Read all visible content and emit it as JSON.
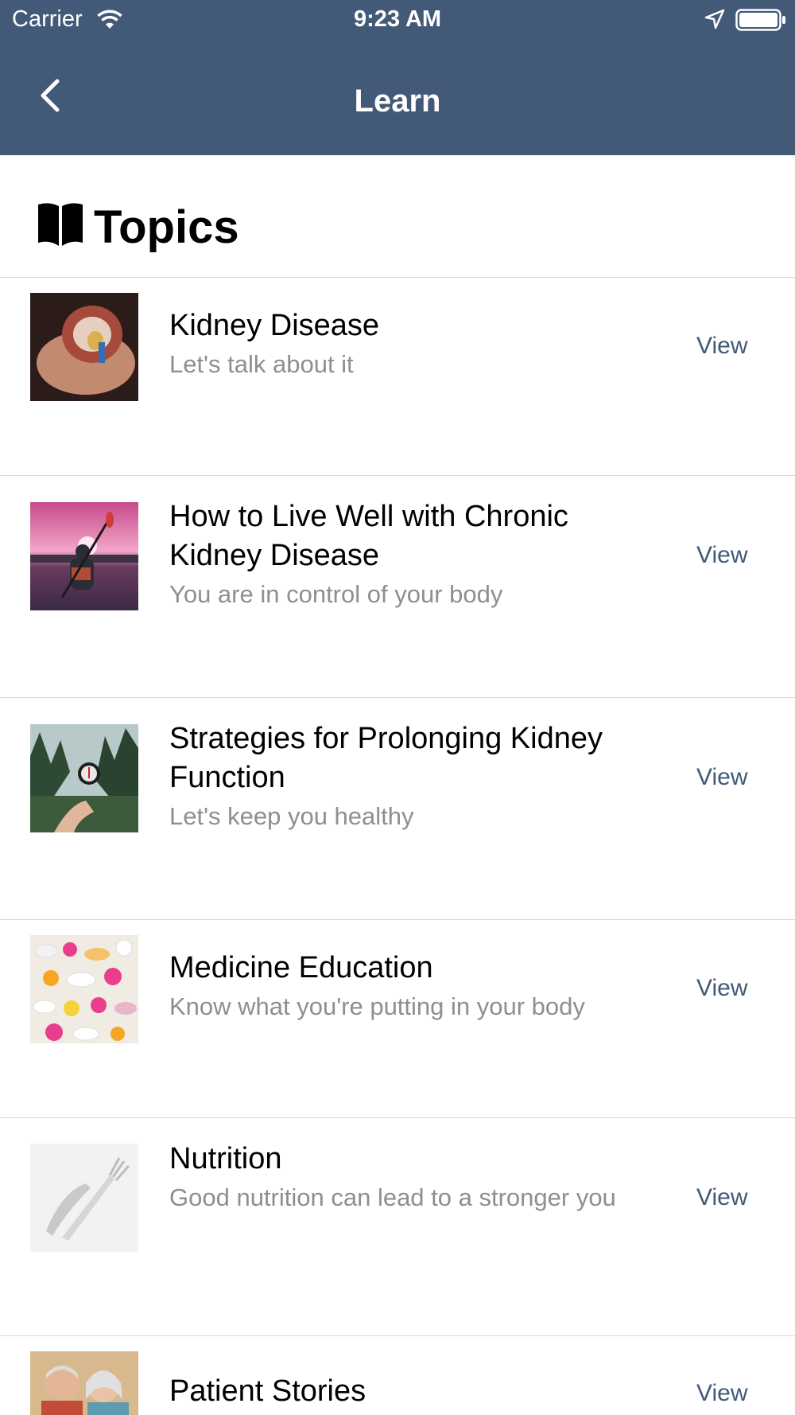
{
  "status_bar": {
    "carrier": "Carrier",
    "time": "9:23 AM",
    "icons": [
      "wifi-icon",
      "location-icon",
      "battery-icon"
    ]
  },
  "nav": {
    "back_icon": "chevron-left-icon",
    "title": "Learn"
  },
  "section": {
    "icon": "book-icon",
    "title": "Topics"
  },
  "topics": [
    {
      "title": "Kidney Disease",
      "subtitle": "Let's talk about it",
      "action": "View",
      "image": "kidney-model-photo"
    },
    {
      "title": "How to Live Well with Chronic Kidney Disease",
      "subtitle": "You are in control of your body",
      "action": "View",
      "image": "kayak-sunset-photo"
    },
    {
      "title": "Strategies for Prolonging Kidney Function",
      "subtitle": "Let's keep you healthy",
      "action": "View",
      "image": "compass-forest-photo"
    },
    {
      "title": "Medicine Education",
      "subtitle": "Know what you're putting in your body",
      "action": "View",
      "image": "pills-photo"
    },
    {
      "title": "Nutrition",
      "subtitle": "Good nutrition can lead to a stronger you",
      "action": "View",
      "image": "fork-knife-photo"
    },
    {
      "title": "Patient Stories",
      "subtitle": "",
      "action": "View",
      "image": "elderly-couple-photo"
    }
  ],
  "colors": {
    "nav_background": "#425a78",
    "accent": "#425a78",
    "subtitle_gray": "#8e8e93",
    "divider": "#d9d9d9"
  }
}
